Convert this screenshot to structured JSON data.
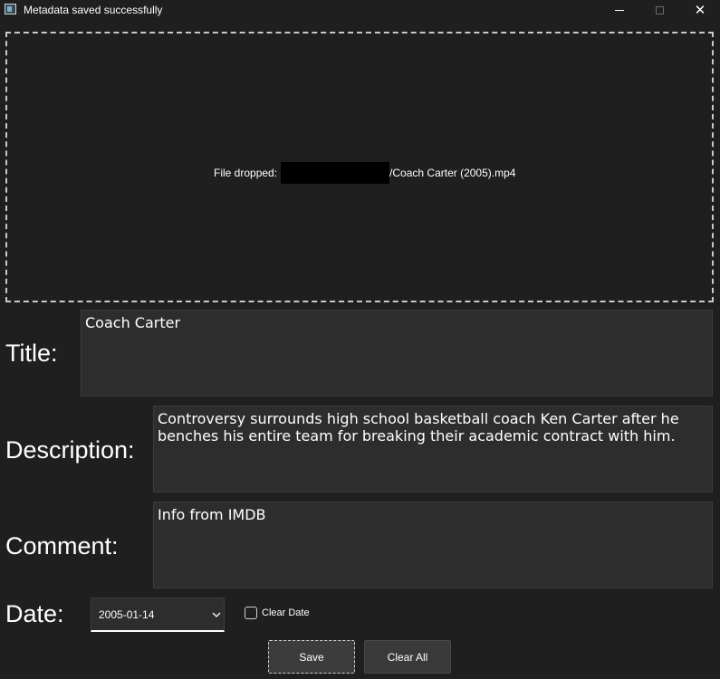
{
  "window": {
    "title": "Metadata saved successfully",
    "controls": {
      "minimize": "minimize",
      "maximize": "maximize",
      "close": "✕"
    }
  },
  "drop_zone": {
    "prefix": "File dropped:",
    "filename": "/Coach Carter (2005).mp4"
  },
  "fields": {
    "title": {
      "label": "Title:",
      "value": "Coach Carter"
    },
    "description": {
      "label": "Description:",
      "value": "Controversy surrounds high school basketball coach Ken Carter after he benches his entire team for breaking their academic contract with him."
    },
    "comment": {
      "label": "Comment:",
      "value": "Info from IMDB"
    },
    "date": {
      "label": "Date:",
      "value": "2005-01-14",
      "clear_label": "Clear Date",
      "clear_checked": false
    }
  },
  "buttons": {
    "save": "Save",
    "clear_all": "Clear All"
  },
  "colors": {
    "background": "#1f1f1f",
    "input_bg": "#2d2d2d",
    "button_bg": "#3a3a3a",
    "dash_border": "#c9c9c9",
    "text": "#ffffff"
  },
  "icons": {
    "app": "app-window-icon",
    "date_dropdown": "chevron-down-icon",
    "close": "close-icon"
  }
}
